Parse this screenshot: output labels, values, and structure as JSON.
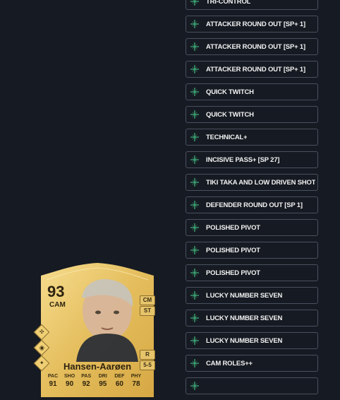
{
  "playstyles": [
    {
      "label": "TRI-CONTROL"
    },
    {
      "label": "ATTACKER ROUND OUT [SP+ 1]"
    },
    {
      "label": "ATTACKER ROUND OUT [SP+ 1]"
    },
    {
      "label": "ATTACKER ROUND OUT [SP+ 1]"
    },
    {
      "label": "QUICK TWITCH"
    },
    {
      "label": "QUICK TWITCH"
    },
    {
      "label": "TECHNICAL+"
    },
    {
      "label": "INCISIVE PASS+ [SP 27]"
    },
    {
      "label": "TIKI TAKA AND LOW DRIVEN SHOT"
    },
    {
      "label": "DEFENDER ROUND OUT [SP 1]"
    },
    {
      "label": "POLISHED PIVOT"
    },
    {
      "label": "POLISHED PIVOT"
    },
    {
      "label": "POLISHED PIVOT"
    },
    {
      "label": "LUCKY NUMBER SEVEN"
    },
    {
      "label": "LUCKY NUMBER SEVEN"
    },
    {
      "label": "LUCKY NUMBER SEVEN"
    },
    {
      "label": "CAM ROLES++"
    },
    {
      "label": ""
    }
  ],
  "card": {
    "rating": "93",
    "position": "CAM",
    "alt_positions": [
      "CM",
      "ST"
    ],
    "preferred_foot": "R",
    "skill_weak_foot": "5-5",
    "name": "Hansen-Aarøen",
    "stat_labels": [
      "PAC",
      "SHO",
      "PAS",
      "DRI",
      "DEF",
      "PHY"
    ],
    "stat_values": [
      "91",
      "90",
      "92",
      "95",
      "60",
      "78"
    ],
    "playstyle_icons": [
      "✣",
      "◉",
      "✦"
    ]
  },
  "colors": {
    "background": "#161a22",
    "pill_border": "#4b5060",
    "icon_green": "#3fae7a",
    "card_gold": "#e8c66b"
  },
  "icons": {
    "pill_icon": "sparkle-plus-icon"
  }
}
